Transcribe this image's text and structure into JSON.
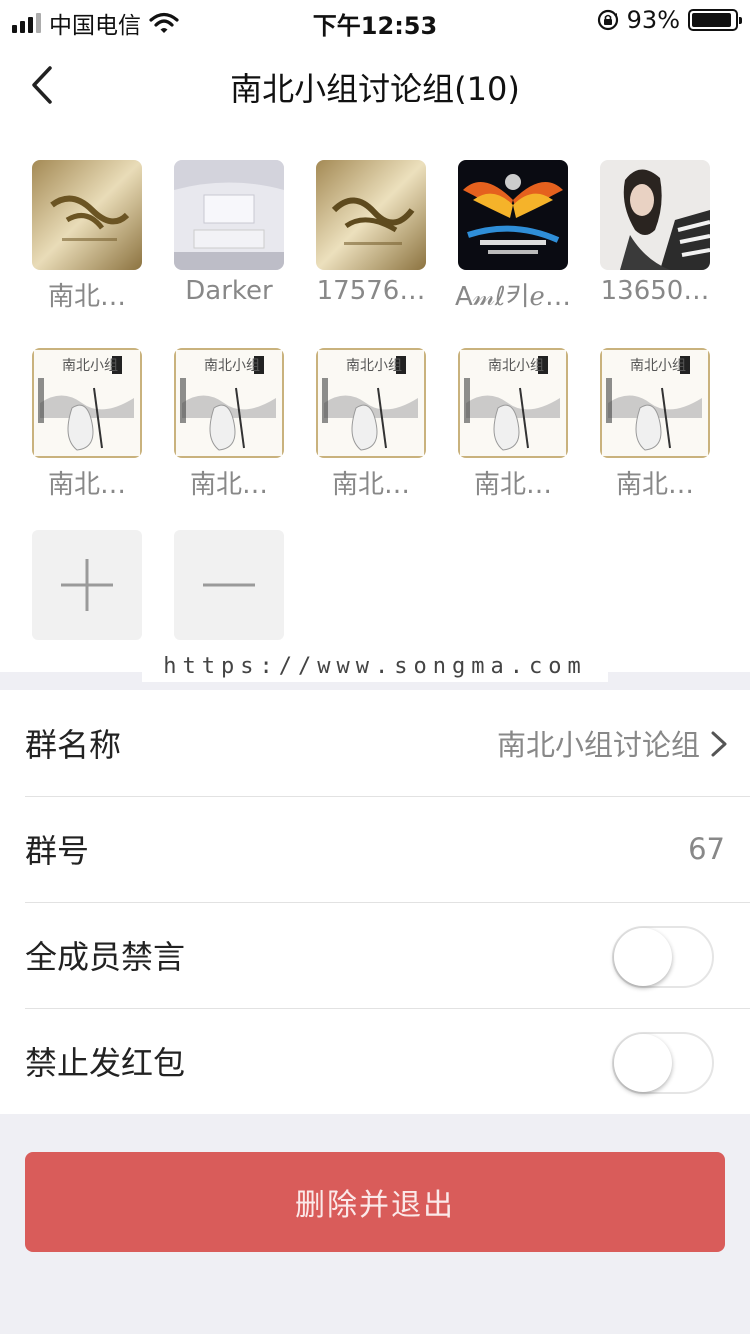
{
  "status_bar": {
    "carrier": "中国电信",
    "time": "下午12:53",
    "battery_percent": "93%",
    "battery_level": 0.93,
    "icons": [
      "signal-icon",
      "wifi-icon",
      "rotation-lock-icon",
      "battery-icon"
    ]
  },
  "nav": {
    "title": "南北小组讨论组(10)",
    "back_icon": "chevron-left-icon"
  },
  "members": [
    {
      "name": "南北…",
      "avatar": "gold-calligraphy"
    },
    {
      "name": "Darker",
      "avatar": "white-room"
    },
    {
      "name": "17576…",
      "avatar": "gold-calligraphy"
    },
    {
      "name": "A𝓂ℓ키ℯ…",
      "avatar": "fire-wings-logo"
    },
    {
      "name": "13650…",
      "avatar": "woman-portrait"
    },
    {
      "name": "南北…",
      "avatar": "ink-painting-poster"
    },
    {
      "name": "南北…",
      "avatar": "ink-painting-poster"
    },
    {
      "name": "南北…",
      "avatar": "ink-painting-poster"
    },
    {
      "name": "南北…",
      "avatar": "ink-painting-poster"
    },
    {
      "name": "南北…",
      "avatar": "ink-painting-poster"
    }
  ],
  "actions": {
    "add_icon": "plus-icon",
    "remove_icon": "minus-icon"
  },
  "watermark": "https://www.songma.com",
  "settings": {
    "group_name_label": "群名称",
    "group_name_value": "南北小组讨论组",
    "group_number_label": "群号",
    "group_number_value": "67",
    "mute_all_label": "全成员禁言",
    "mute_all_on": false,
    "no_red_packet_label": "禁止发红包",
    "no_red_packet_on": false
  },
  "delete_exit_label": "删除并退出",
  "colors": {
    "danger": "#d95c5a",
    "background": "#efeff4"
  }
}
